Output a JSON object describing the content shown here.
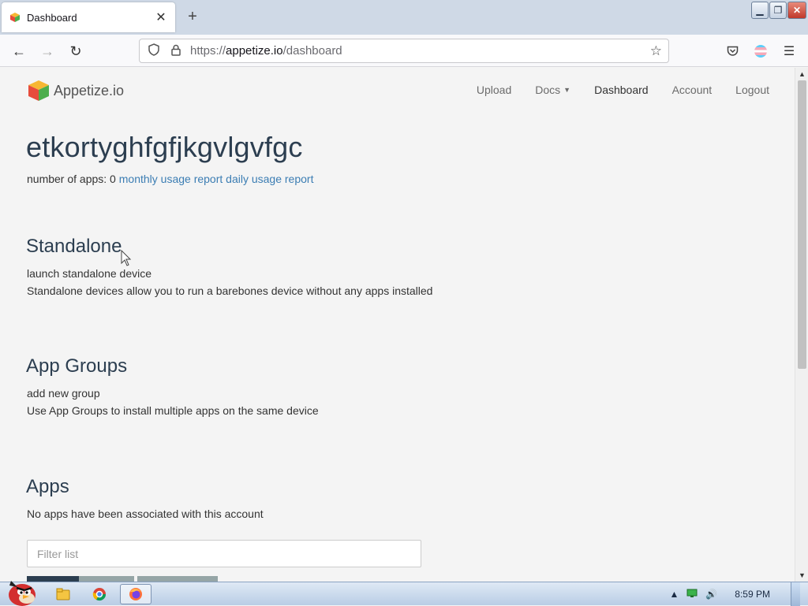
{
  "browser": {
    "tab_title": "Dashboard",
    "new_tab": "+",
    "url_scheme": "https://",
    "url_host": "appetize.io",
    "url_path": "/dashboard"
  },
  "site": {
    "brand": "Appetize.io",
    "nav": {
      "upload": "Upload",
      "docs": "Docs",
      "dashboard": "Dashboard",
      "account": "Account",
      "logout": "Logout"
    }
  },
  "account": {
    "name": "etkortyghfgfjkgvlgvfgc",
    "apps_count_label": "number of apps: 0",
    "monthly_report": "monthly usage report",
    "daily_report": "daily usage report"
  },
  "standalone": {
    "heading": "Standalone",
    "link": "launch standalone device",
    "description": "Standalone devices allow you to run a barebones device without any apps installed"
  },
  "app_groups": {
    "heading": "App Groups",
    "link": "add new group",
    "description": "Use App Groups to install multiple apps on the same device"
  },
  "apps": {
    "heading": "Apps",
    "empty_message": "No apps have been associated with this account",
    "filter_placeholder": "Filter list"
  },
  "taskbar": {
    "clock": "8:59 PM"
  },
  "colors": {
    "link": "#3b7db3",
    "heading": "#2c3e50",
    "page_bg": "#f4f4f4"
  }
}
